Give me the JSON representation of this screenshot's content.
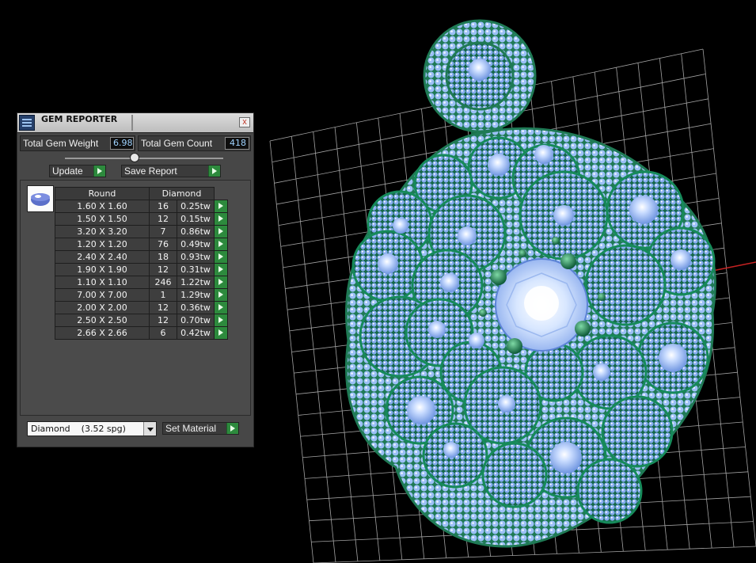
{
  "panel": {
    "title": "GEM REPORTER",
    "close_label": "x",
    "total_weight_label": "Total Gem Weight",
    "total_weight_value": "6.98",
    "total_count_label": "Total Gem Count",
    "total_count_value": "418",
    "update_label": "Update",
    "save_report_label": "Save Report",
    "table": {
      "headers": [
        "Round",
        "Diamond"
      ],
      "rows": [
        {
          "size": "1.60 X 1.60",
          "count": "16",
          "weight": "0.25tw"
        },
        {
          "size": "1.50 X 1.50",
          "count": "12",
          "weight": "0.15tw"
        },
        {
          "size": "3.20 X 3.20",
          "count": "7",
          "weight": "0.86tw"
        },
        {
          "size": "1.20 X 1.20",
          "count": "76",
          "weight": "0.49tw"
        },
        {
          "size": "2.40 X 2.40",
          "count": "18",
          "weight": "0.93tw"
        },
        {
          "size": "1.90 X 1.90",
          "count": "12",
          "weight": "0.31tw"
        },
        {
          "size": "1.10 X 1.10",
          "count": "246",
          "weight": "1.22tw"
        },
        {
          "size": "7.00 X 7.00",
          "count": "1",
          "weight": "1.29tw"
        },
        {
          "size": "2.00 X 2.00",
          "count": "12",
          "weight": "0.36tw"
        },
        {
          "size": "2.50 X 2.50",
          "count": "12",
          "weight": "0.70tw"
        },
        {
          "size": "2.66 X 2.66",
          "count": "6",
          "weight": "0.42tw"
        }
      ]
    },
    "material_value": "Diamond    (3.52 spg)",
    "set_material_label": "Set Material"
  },
  "colors": {
    "background": "#000000",
    "gem_blue": "#8fb8f5",
    "metal_green": "#1f7a55",
    "grid": "#bfbfbf",
    "axis": "#c62222",
    "go_button": "#2d8a3d"
  }
}
